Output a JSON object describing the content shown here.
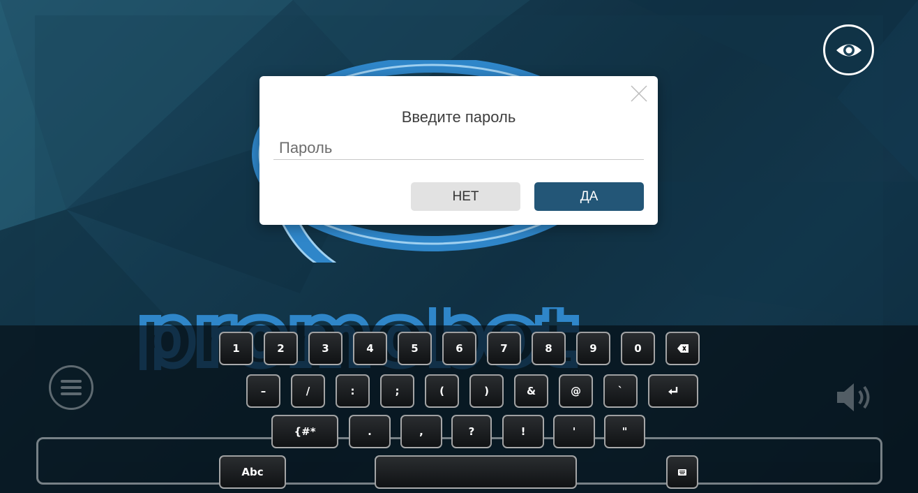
{
  "dialog": {
    "title": "Введите пароль",
    "password_placeholder": "Пароль",
    "password_value": "",
    "no_label": "НЕТ",
    "yes_label": "ДА"
  },
  "icons": {
    "eye": "eye-icon",
    "close": "close-icon",
    "menu": "menu-icon",
    "speaker": "speaker-icon",
    "backspace": "backspace-icon",
    "enter": "enter-icon",
    "hide_keyboard": "keyboard-hide-icon"
  },
  "keyboard": {
    "row1": [
      "1",
      "2",
      "3",
      "4",
      "5",
      "6",
      "7",
      "8",
      "9",
      "0"
    ],
    "row2": [
      "–",
      "/",
      ":",
      ";",
      "(",
      ")",
      "&",
      "@",
      "`"
    ],
    "row3_symbols": "{#*",
    "row3": [
      ".",
      ",",
      "?",
      "!",
      "'",
      "\""
    ],
    "abc": "Abc"
  },
  "colors": {
    "accent": "#235677",
    "background": "#16394d",
    "logo_blue": "#2f86c9"
  }
}
